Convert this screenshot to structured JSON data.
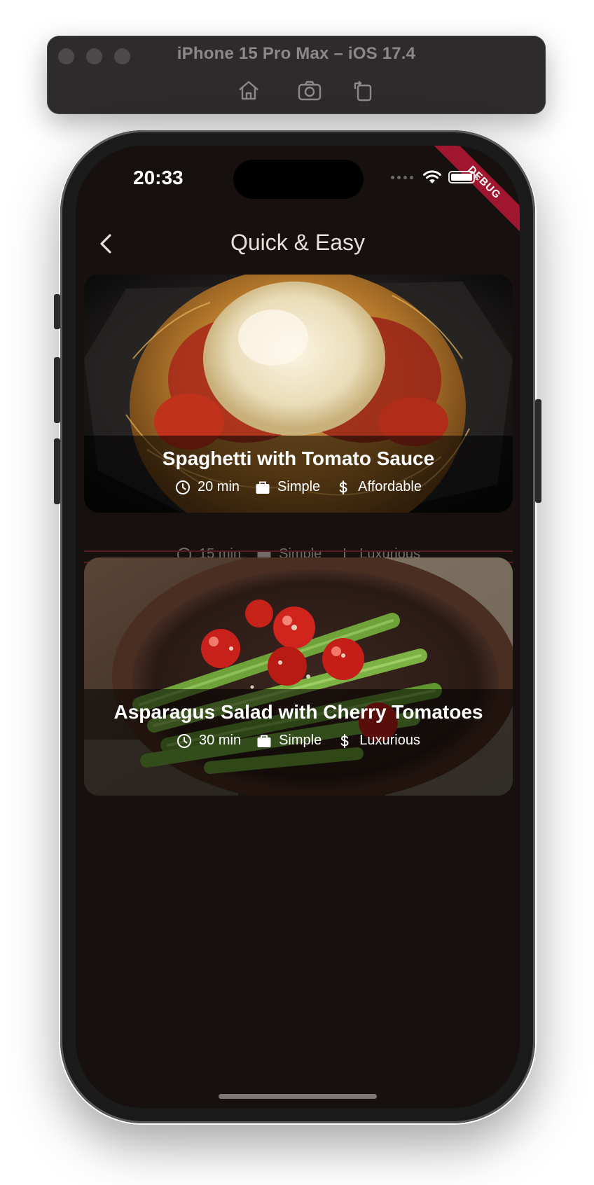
{
  "simulator": {
    "title": "iPhone 15 Pro Max – iOS 17.4",
    "tools": [
      "home-icon",
      "screenshot-icon",
      "rotate-icon"
    ]
  },
  "status_bar": {
    "time": "20:33",
    "debug_label": "DEBUG"
  },
  "app_bar": {
    "title": "Quick & Easy"
  },
  "meals": [
    {
      "title": "Spaghetti with Tomato Sauce",
      "duration": "20 min",
      "complexity": "Simple",
      "affordability": "Affordable"
    },
    {
      "title": "Asparagus Salad with Cherry Tomatoes",
      "duration": "30 min",
      "complexity": "Simple",
      "affordability": "Luxurious"
    }
  ],
  "ghost_row": {
    "duration": "15 min",
    "complexity": "Simple",
    "affordability": "Luxurious"
  },
  "colors": {
    "background": "#16110f",
    "title_text": "#e9dfdb",
    "debug_ribbon": "#a0162f"
  }
}
